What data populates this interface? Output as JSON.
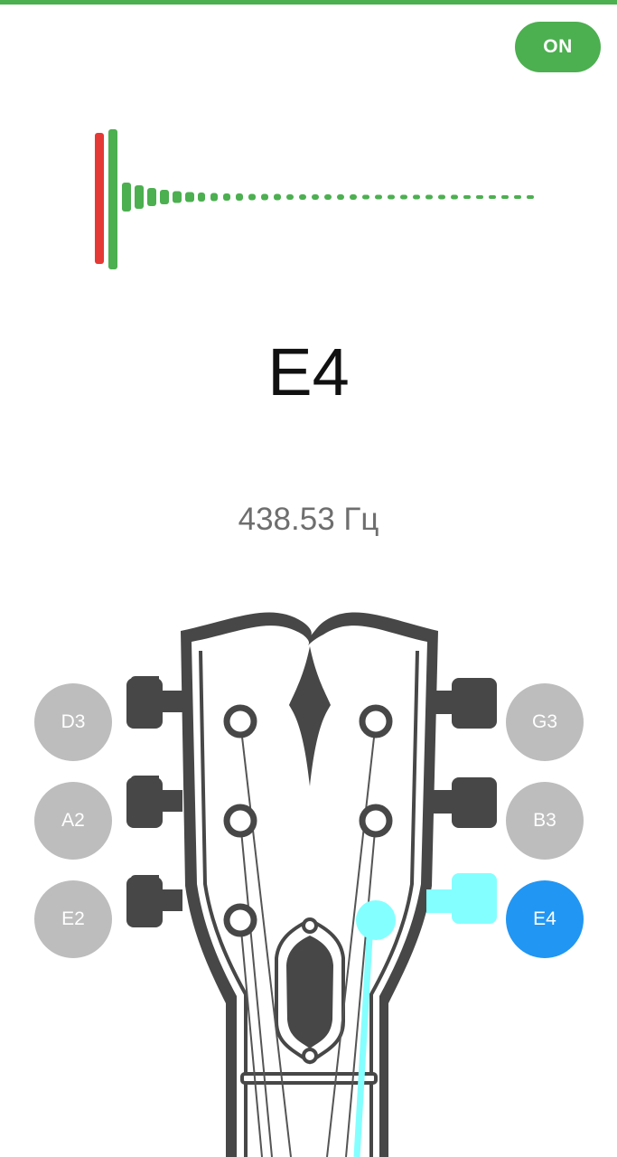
{
  "toggle": {
    "label": "ON",
    "state": "on"
  },
  "tuner": {
    "note": "E4",
    "frequency": "438.53 Гц",
    "active_string": "E4"
  },
  "strings": {
    "left": [
      {
        "label": "D3"
      },
      {
        "label": "A2"
      },
      {
        "label": "E2"
      }
    ],
    "right": [
      {
        "label": "G3"
      },
      {
        "label": "B3"
      },
      {
        "label": "E4"
      }
    ]
  },
  "colors": {
    "accent": "#4caf50",
    "off_pitch": "#e53935",
    "active_string": "#2196f3",
    "inactive_string": "#bdbdbd",
    "highlight": "#84ffff",
    "headstock": "#474747"
  }
}
